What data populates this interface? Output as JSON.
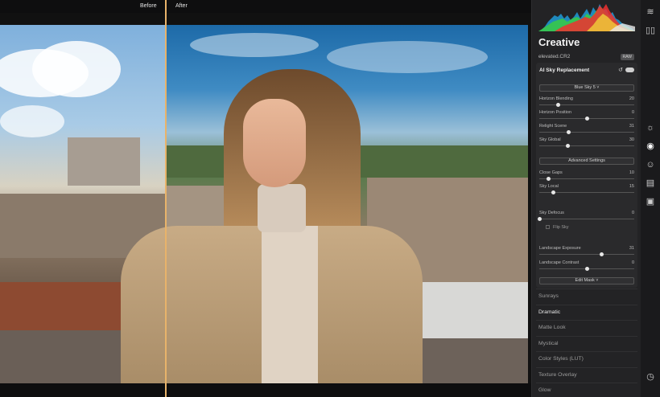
{
  "canvas": {
    "before_label": "Before",
    "after_label": "After"
  },
  "panel": {
    "title": "Creative",
    "filename": "elevated.CR2",
    "file_badge": "RAW",
    "module": {
      "title": "AI Sky Replacement",
      "sky_select": "Blue Sky 5 ˅",
      "advanced_button": "Advanced Settings",
      "edit_mask_button": "Edit Mask ˅",
      "flip_sky_label": "Flip Sky",
      "sliders_top": [
        {
          "name": "Horizon Blending",
          "value": "20",
          "fraction": 0.2
        },
        {
          "name": "Horizon Position",
          "value": "0",
          "fraction": 0.5
        },
        {
          "name": "Relight Scene",
          "value": "31",
          "fraction": 0.31
        },
        {
          "name": "Sky Global",
          "value": "30",
          "fraction": 0.3
        }
      ],
      "sliders_advanced": [
        {
          "name": "Close Gaps",
          "value": "10",
          "fraction": 0.1
        },
        {
          "name": "Sky Local",
          "value": "15",
          "fraction": 0.15
        }
      ],
      "sliders_defocus": [
        {
          "name": "Sky Defocus",
          "value": "0",
          "fraction": 0.0
        }
      ],
      "sliders_landscape": [
        {
          "name": "Landscape Exposure",
          "value": "31",
          "fraction": 0.66
        },
        {
          "name": "Landscape Contrast",
          "value": "0",
          "fraction": 0.5
        }
      ]
    },
    "tools": [
      "Sunrays",
      "Dramatic",
      "Matte Look",
      "Mystical",
      "Color Styles (LUT)",
      "Texture Overlay",
      "Glow"
    ]
  },
  "colors": {
    "accent_divider": "#e8b36a",
    "panel_bg": "#232325"
  },
  "toolbar_icons": [
    "layers-icon",
    "compare-icon",
    "sun-icon",
    "palette-icon",
    "face-icon",
    "photo-icon",
    "briefcase-icon",
    "history-icon"
  ]
}
